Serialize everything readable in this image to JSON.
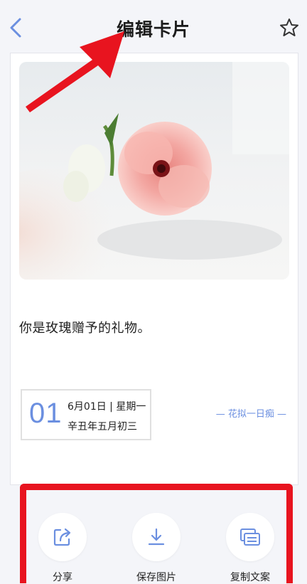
{
  "header": {
    "title": "编辑卡片",
    "back_icon": "chevron-left-icon",
    "favorite_icon": "star-outline-icon"
  },
  "card": {
    "quote": "你是玫瑰赠予的礼物。",
    "date": {
      "day": "01",
      "line1": "6月01日 | 星期一",
      "line2": "辛丑年五月初三"
    },
    "signature": "— 花拟一日痴 —"
  },
  "actions": [
    {
      "label": "分享",
      "icon": "share-icon"
    },
    {
      "label": "保存图片",
      "icon": "download-icon"
    },
    {
      "label": "复制文案",
      "icon": "copy-icon"
    }
  ],
  "colors": {
    "accent": "#6b8fe0",
    "highlight_red": "#e8141f",
    "background": "#f4f5f9"
  }
}
